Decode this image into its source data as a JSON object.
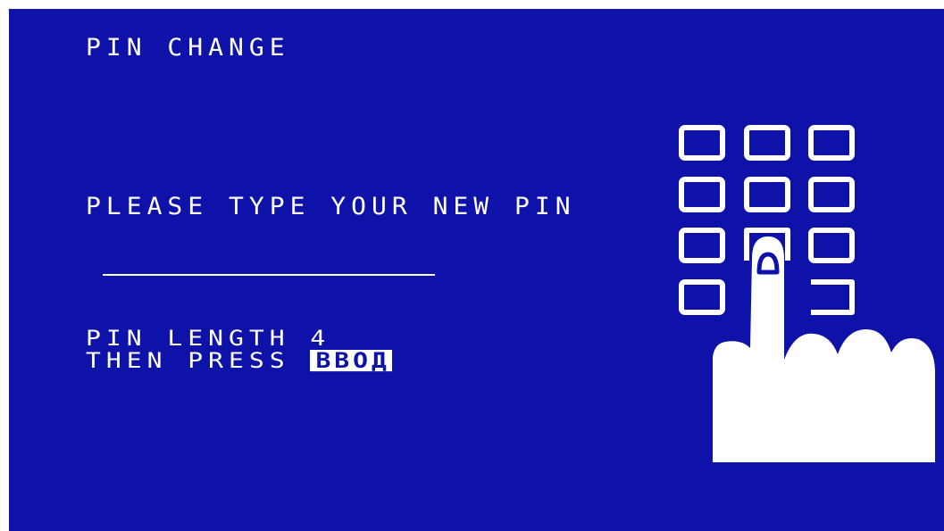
{
  "screen": {
    "title": "PIN CHANGE",
    "prompt": "PLEASE TYPE YOUR NEW PIN",
    "pin_length_text": "PIN LENGTH 4",
    "then_press_text": "THEN PRESS ",
    "enter_key_label": "ВВОД"
  },
  "colors": {
    "background": "#0f12a8",
    "foreground": "#ffffff"
  },
  "illustration": {
    "keypad-icon": "keypad with pressing finger"
  }
}
